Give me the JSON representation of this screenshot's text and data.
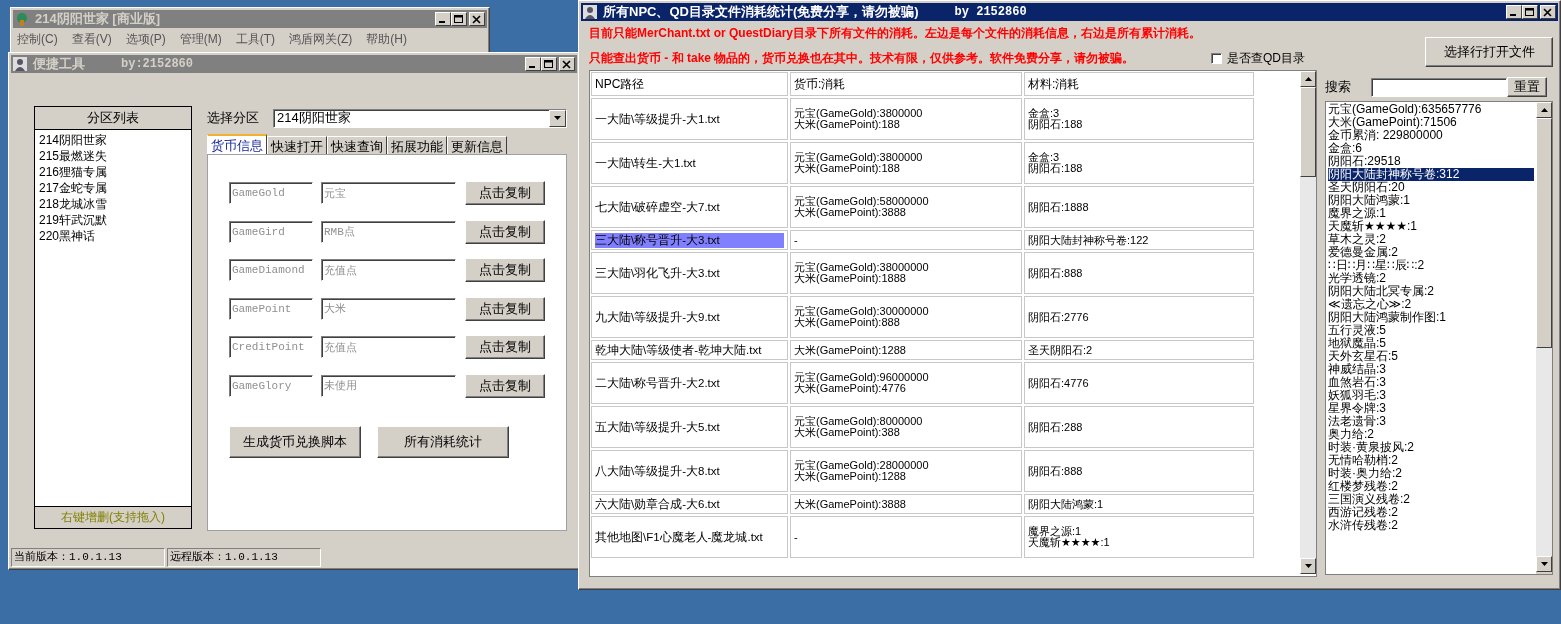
{
  "main_window": {
    "title": "214阴阳世家 [商业版]",
    "active": false,
    "menu": [
      "控制(C)",
      "查看(V)",
      "选项(P)",
      "管理(M)",
      "工具(T)",
      "鸿盾网关(Z)",
      "帮助(H)"
    ]
  },
  "tool_window": {
    "title": "便捷工具",
    "author": "by:2152860",
    "active": false,
    "partition_list": {
      "header": "分区列表",
      "footer": "右键增删(支持拖入)",
      "items": [
        "214阴阳世家",
        "215最燃迷失",
        "216狸猫专属",
        "217金蛇专属",
        "218龙城冰雪",
        "219轩武沉默",
        "220黑神话"
      ]
    },
    "partition_label": "选择分区",
    "partition_value": "214阴阳世家",
    "tabs": [
      {
        "label": "货币信息",
        "selected": true
      },
      {
        "label": "快速打开",
        "selected": false
      },
      {
        "label": "快速查询",
        "selected": false
      },
      {
        "label": "拓展功能",
        "selected": false
      },
      {
        "label": "更新信息",
        "selected": false
      }
    ],
    "currencies": [
      {
        "field": "GameGold",
        "name": "元宝",
        "disabled": true,
        "button": "点击复制"
      },
      {
        "field": "GameGird",
        "name": "RMB点",
        "disabled": true,
        "button": "点击复制"
      },
      {
        "field": "GameDiamond",
        "name": "充值点",
        "disabled": true,
        "button": "点击复制"
      },
      {
        "field": "GamePoint",
        "name": "大米",
        "disabled": true,
        "button": "点击复制"
      },
      {
        "field": "CreditPoint",
        "name": "充值点",
        "disabled": true,
        "button": "点击复制"
      },
      {
        "field": "GameGlory",
        "name": "未使用",
        "disabled": true,
        "button": "点击复制"
      }
    ],
    "actions": [
      "生成货币兑换脚本",
      "所有消耗统计"
    ],
    "status_bar": [
      "当前版本：1.0.1.13",
      "远程版本：1.0.1.13"
    ]
  },
  "stats_window": {
    "title": "所有NPC、QD目录文件消耗统计(免费分享，请勿被骗)",
    "author": "by 2152860",
    "active": true,
    "notices": [
      "目前只能MerChant.txt or QuestDiary目录下所有文件的消耗。左边是每个文件的消耗信息，右边是所有累计消耗。",
      "只能查出货币 - 和 take 物品的，货币兑换也在其中。技术有限，仅供参考。软件免费分享，请勿被骗。"
    ],
    "qd_checkbox": {
      "label": "是否查QD目录",
      "checked": false
    },
    "open_button": "选择行打开文件",
    "table": {
      "columns": [
        "NPC路径",
        "货币:消耗",
        "材料:消耗"
      ],
      "rows": [
        {
          "path": "一大陆\\等级提升-大1.txt",
          "currency": [
            "元宝(GameGold):3800000",
            "大米(GamePoint):188"
          ],
          "materials": [
            "金盒:3",
            "阴阳石:188"
          ],
          "selected": false
        },
        {
          "path": "一大陆\\转生-大1.txt",
          "currency": [
            "元宝(GameGold):3800000",
            "大米(GamePoint):188"
          ],
          "materials": [
            "金盒:3",
            "阴阳石:188"
          ],
          "selected": false
        },
        {
          "path": "七大陆\\破碎虚空-大7.txt",
          "currency": [
            "元宝(GameGold):58000000",
            "大米(GamePoint):3888"
          ],
          "materials": [
            "阴阳石:1888"
          ],
          "selected": false
        },
        {
          "path": "三大陆\\称号晋升-大3.txt",
          "currency": [
            "-"
          ],
          "materials": [
            "阴阳大陆封神称号卷:122"
          ],
          "selected": true
        },
        {
          "path": "三大陆\\羽化飞升-大3.txt",
          "currency": [
            "元宝(GameGold):38000000",
            "大米(GamePoint):1888"
          ],
          "materials": [
            "阴阳石:888"
          ],
          "selected": false
        },
        {
          "path": "九大陆\\等级提升-大9.txt",
          "currency": [
            "元宝(GameGold):30000000",
            "大米(GamePoint):888"
          ],
          "materials": [
            "阴阳石:2776"
          ],
          "selected": false
        },
        {
          "path": "乾坤大陆\\等级使者-乾坤大陆.txt",
          "currency": [
            "大米(GamePoint):1288"
          ],
          "materials": [
            "圣天阴阳石:2"
          ],
          "selected": false
        },
        {
          "path": "二大陆\\称号晋升-大2.txt",
          "currency": [
            "元宝(GameGold):96000000",
            "大米(GamePoint):4776"
          ],
          "materials": [
            "阴阳石:4776"
          ],
          "selected": false
        },
        {
          "path": "五大陆\\等级提升-大5.txt",
          "currency": [
            "元宝(GameGold):8000000",
            "大米(GamePoint):388"
          ],
          "materials": [
            "阴阳石:288"
          ],
          "selected": false
        },
        {
          "path": "八大陆\\等级提升-大8.txt",
          "currency": [
            "元宝(GameGold):28000000",
            "大米(GamePoint):1288"
          ],
          "materials": [
            "阴阳石:888"
          ],
          "selected": false
        },
        {
          "path": "六大陆\\勋章合成-大6.txt",
          "currency": [
            "大米(GamePoint):3888"
          ],
          "materials": [
            "阴阳大陆鸿蒙:1"
          ],
          "selected": false
        },
        {
          "path": "其他地图\\F1心魔老人-魔龙城.txt",
          "currency": [
            "-"
          ],
          "materials": [
            "魔界之源:1",
            "天魔斩★★★★:1"
          ],
          "selected": false
        }
      ]
    },
    "search": {
      "label": "搜索",
      "reset": "重置"
    },
    "totals": [
      {
        "text": "元宝(GameGold):635657776",
        "selected": false
      },
      {
        "text": "大米(GamePoint):71506",
        "selected": false
      },
      {
        "text": "金币累消: 229800000",
        "selected": false
      },
      {
        "text": "金盒:6",
        "selected": false
      },
      {
        "text": "阴阳石:29518",
        "selected": false
      },
      {
        "text": "阴阳大陆封神称号卷:312",
        "selected": true
      },
      {
        "text": "圣天阴阳石:20",
        "selected": false
      },
      {
        "text": "阴阳大陆鸿蒙:1",
        "selected": false
      },
      {
        "text": "魔界之源:1",
        "selected": false
      },
      {
        "text": "天魔斩★★★★:1",
        "selected": false
      },
      {
        "text": "草木之灵:2",
        "selected": false
      },
      {
        "text": "爱德曼金属:2",
        "selected": false
      },
      {
        "text": "∷日∷月∷星∷辰∷:2",
        "selected": false
      },
      {
        "text": "光学透镜:2",
        "selected": false
      },
      {
        "text": "阴阳大陆北冥专属:2",
        "selected": false
      },
      {
        "text": "≪遗忘之心≫:2",
        "selected": false
      },
      {
        "text": "阴阳大陆鸿蒙制作图:1",
        "selected": false
      },
      {
        "text": "五行灵液:5",
        "selected": false
      },
      {
        "text": "地狱魔晶:5",
        "selected": false
      },
      {
        "text": "天外玄星石:5",
        "selected": false
      },
      {
        "text": "神威结晶:3",
        "selected": false
      },
      {
        "text": "血煞岩石:3",
        "selected": false
      },
      {
        "text": "妖狐羽毛:3",
        "selected": false
      },
      {
        "text": "星界令牌:3",
        "selected": false
      },
      {
        "text": "法老遗骨:3",
        "selected": false
      },
      {
        "text": "奥力给:2",
        "selected": false
      },
      {
        "text": "时装·黄泉披风:2",
        "selected": false
      },
      {
        "text": "无情哈勒梢:2",
        "selected": false
      },
      {
        "text": "时装·奥力给:2",
        "selected": false
      },
      {
        "text": "红楼梦残卷:2",
        "selected": false
      },
      {
        "text": "三国演义残卷:2",
        "selected": false
      },
      {
        "text": "西游记残卷:2",
        "selected": false
      },
      {
        "text": "水浒传残卷:2",
        "selected": false
      }
    ]
  }
}
